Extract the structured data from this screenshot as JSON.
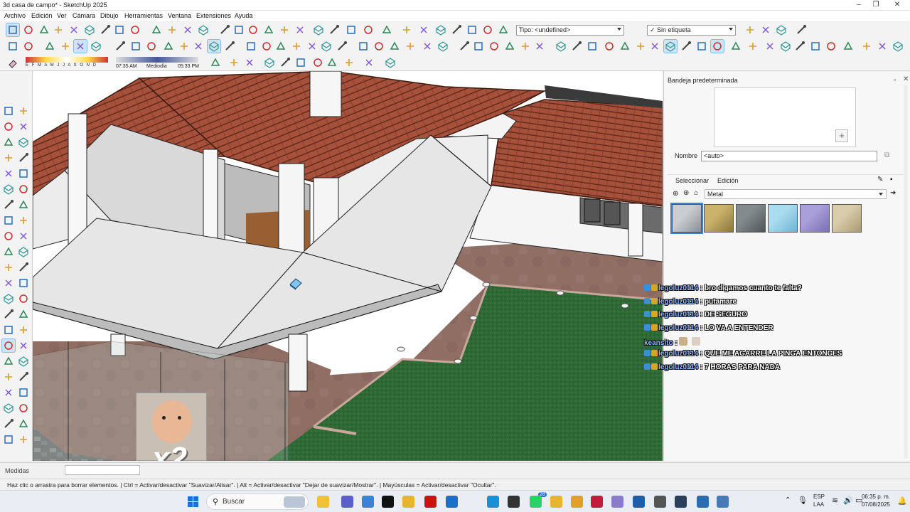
{
  "window": {
    "title": "3d casa de campo* - SketchUp 2025",
    "controls": [
      "–",
      "❐",
      "✕"
    ]
  },
  "menu": [
    "Archivo",
    "Edición",
    "Ver",
    "Cámara",
    "Dibujo",
    "Herramientas",
    "Ventana",
    "Extensiones",
    "Ayuda"
  ],
  "toolbar": {
    "tag_type": "Tipo: <undefined>",
    "tag_label": "Sin etiqueta",
    "months": "E F M A M J J A S O N D",
    "time_start": "07:35 AM",
    "time_mid": "Mediodía",
    "time_end": "05:33 PM"
  },
  "tray": {
    "title": "Bandeja predeterminada",
    "name_label": "Nombre",
    "name_value": "<auto>",
    "tabs": [
      "Seleccionar",
      "Edición"
    ],
    "library": "Metal",
    "swatches": [
      {
        "name": "metal-aluminum",
        "color": "#8a8f94",
        "color2": "#c9cdd1"
      },
      {
        "name": "metal-gold",
        "color": "#8a7740",
        "color2": "#c9b26a"
      },
      {
        "name": "metal-dark",
        "color": "#4e5457",
        "color2": "#828a8e"
      },
      {
        "name": "metal-blue",
        "color": "#6db3cf",
        "color2": "#a9dcef"
      },
      {
        "name": "metal-purple",
        "color": "#7a6fb0",
        "color2": "#a89ed8"
      },
      {
        "name": "metal-sand",
        "color": "#a89a72",
        "color2": "#d8ccaa"
      }
    ]
  },
  "chat": [
    {
      "user": "legoluz0114",
      "msg": "bro digamos cuanto te falta?"
    },
    {
      "user": "legoluz0114",
      "msg": "putamare"
    },
    {
      "user": "legoluz0114",
      "msg": "DE SEGURO"
    },
    {
      "user": "legoluz0114",
      "msg": "LO VA A ENTENDER"
    },
    {
      "user": "keansito",
      "msg": ""
    },
    {
      "user": "legoluz0114",
      "msg": "QUE ME AGARRE LA PINGA ENTONCES"
    },
    {
      "user": "legoluz0114",
      "msg": "7 HORAS PARA NADA"
    }
  ],
  "overlay": {
    "multiplier": "x2"
  },
  "measurements": {
    "label": "Medidas",
    "value": ""
  },
  "status": "Haz clic o arrastra para borrar elementos. | Ctrl = Activar/desactivar \"Suavizar/Alisar\". | Alt = Activar/desactivar \"Dejar de suavizar/Mostrar\". | Mayúsculas = Activar/desactivar \"Ocultar\".",
  "taskbar": {
    "search": "Buscar",
    "lang1": "ESP",
    "lang2": "LAA",
    "time": "06:35 p. m.",
    "date": "07/08/2025",
    "badge": "28"
  },
  "colors": {
    "roof": "#9e4a35",
    "wall": "#f2f2f2",
    "floor": "#8e6e64",
    "grass": "#2e6b35",
    "accent": "#3b82d6"
  }
}
